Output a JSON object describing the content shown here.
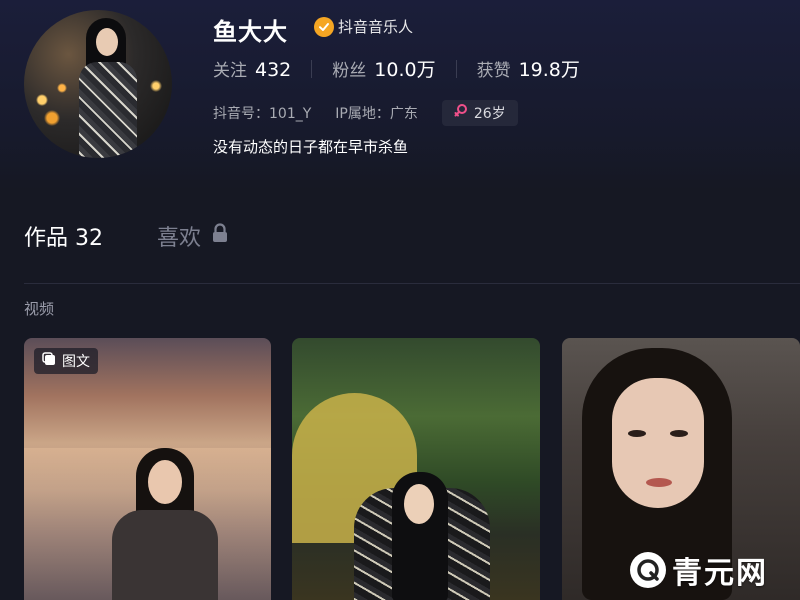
{
  "profile": {
    "name": "鱼大大",
    "verified_label": "抖音音乐人",
    "stats": {
      "following_label": "关注",
      "following_value": "432",
      "followers_label": "粉丝",
      "followers_value": "10.0万",
      "likes_label": "获赞",
      "likes_value": "19.8万"
    },
    "douyin_id": "抖音号：101_Y",
    "ip_location": "IP属地：广东",
    "age": "26岁",
    "bio": "没有动态的日子都在早市杀鱼"
  },
  "tabs": {
    "works_label": "作品 32",
    "likes_label": "喜欢"
  },
  "section": {
    "title": "视频"
  },
  "cards": [
    {
      "tag": "图文"
    }
  ],
  "watermark": {
    "text": "青元网"
  },
  "colors": {
    "background": "#161823",
    "verified": "#f5a623",
    "female_icon": "#f0508a"
  }
}
